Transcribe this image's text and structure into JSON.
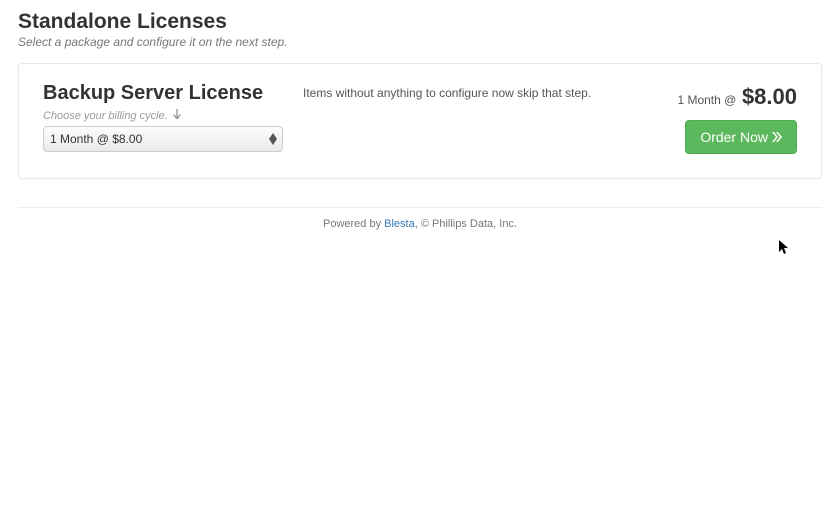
{
  "header": {
    "title": "Standalone Licenses",
    "subtitle": "Select a package and configure it on the next step."
  },
  "product": {
    "name": "Backup Server License",
    "cycle_label": "Choose your billing cycle.",
    "selected_option": "1 Month @ $8.00",
    "description": "Items without anything to configure now skip that step.",
    "price_term": "1 Month @",
    "price_amount": "$8.00",
    "order_label": "Order Now"
  },
  "footer": {
    "powered": "Powered by ",
    "brand": "Blesta",
    "tail": ", © Phillips Data, Inc."
  }
}
